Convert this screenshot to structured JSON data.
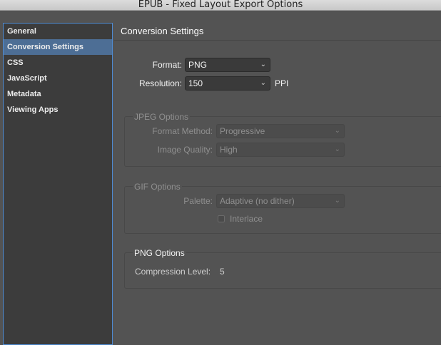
{
  "window": {
    "title": "EPUB - Fixed Layout Export Options"
  },
  "sidebar": {
    "items": [
      {
        "label": "General",
        "selected": false
      },
      {
        "label": "Conversion Settings",
        "selected": true
      },
      {
        "label": "CSS",
        "selected": false
      },
      {
        "label": "JavaScript",
        "selected": false
      },
      {
        "label": "Metadata",
        "selected": false
      },
      {
        "label": "Viewing Apps",
        "selected": false
      }
    ]
  },
  "main": {
    "heading": "Conversion Settings",
    "format": {
      "label": "Format:",
      "value": "PNG"
    },
    "resolution": {
      "label": "Resolution:",
      "value": "150",
      "unit": "PPI"
    },
    "jpeg_options": {
      "title": "JPEG Options",
      "format_method": {
        "label": "Format Method:",
        "value": "Progressive"
      },
      "image_quality": {
        "label": "Image Quality:",
        "value": "High"
      }
    },
    "gif_options": {
      "title": "GIF Options",
      "palette": {
        "label": "Palette:",
        "value": "Adaptive (no dither)"
      },
      "interlace": {
        "label": "Interlace",
        "checked": false
      }
    },
    "png_options": {
      "title": "PNG Options",
      "compression": {
        "label": "Compression Level:",
        "value": "5"
      }
    }
  },
  "icons": {
    "dropdown": "chevron-down-icon"
  },
  "colors": {
    "selection": "#4d6e95",
    "focus_border": "#4e8ad0",
    "background": "#535353"
  }
}
